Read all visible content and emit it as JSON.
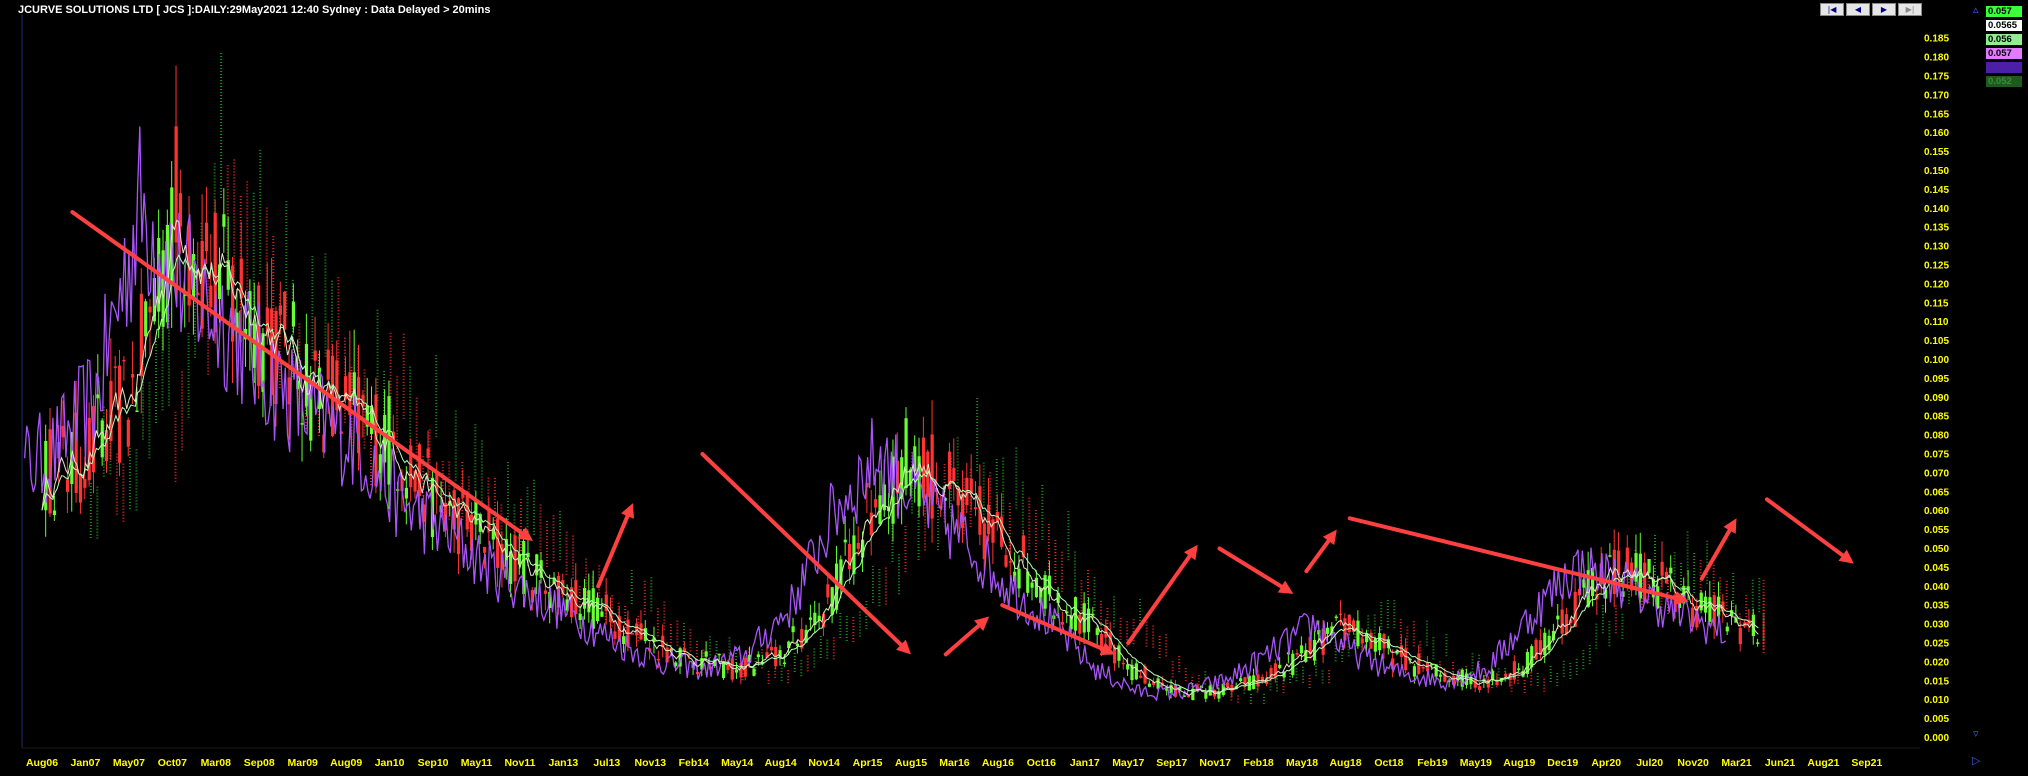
{
  "header": {
    "title": "JCURVE SOLUTIONS LTD [ JCS ]:DAILY:29May2021 12:40 Sydney : Data Delayed > 20mins"
  },
  "navigation": {
    "buttons": [
      {
        "label": "|◀",
        "enabled": true
      },
      {
        "label": "◀",
        "enabled": true
      },
      {
        "label": "▶",
        "enabled": true
      },
      {
        "label": "▶|",
        "enabled": false
      }
    ],
    "scroll_up_icon": "▵",
    "scroll_down_icon": "▿",
    "scroll_right_icon": "▷"
  },
  "price_tags": [
    {
      "value": "0.057",
      "bg": "#3cff3c",
      "fg": "#000000"
    },
    {
      "value": "0.0565",
      "bg": "#ffffff",
      "fg": "#000000"
    },
    {
      "value": "0.056",
      "bg": "#90ee90",
      "fg": "#000000"
    },
    {
      "value": "0.057",
      "bg": "#e27bff",
      "fg": "#000000"
    },
    {
      "value": "",
      "bg": "#4b1fa6",
      "fg": "#4b1fa6"
    },
    {
      "value": "0.052",
      "bg": "#1e5a1e",
      "fg": "#3a8a3a"
    }
  ],
  "colors": {
    "background": "#000000",
    "axis_text": "#ffff00",
    "up_candle": "#66ff33",
    "down_candle": "#ff3333",
    "lagging_line": "#a855f7",
    "ma_line": "#e6e6c8",
    "ma_line_2": "#b6ffb6",
    "cloud_red": "#ff3030",
    "cloud_green": "#22aa22",
    "annotation_arrow": "#ff4040"
  },
  "chart_data": {
    "type": "line",
    "x_tick_labels": [
      "Aug06",
      "Jan07",
      "May07",
      "Oct07",
      "Mar08",
      "Sep08",
      "Mar09",
      "Aug09",
      "Jan10",
      "Sep10",
      "May11",
      "Nov11",
      "Jan13",
      "Jul13",
      "Nov13",
      "Feb14",
      "May14",
      "Aug14",
      "Nov14",
      "Apr15",
      "Aug15",
      "Mar16",
      "Aug16",
      "Oct16",
      "Jan17",
      "May17",
      "Sep17",
      "Nov17",
      "Feb18",
      "May18",
      "Aug18",
      "Oct18",
      "Feb19",
      "May19",
      "Aug19",
      "Dec19",
      "Apr20",
      "Jul20",
      "Nov20",
      "Mar21",
      "Jun21",
      "Aug21",
      "Sep21"
    ],
    "y_tick_labels": [
      "0.185",
      "0.180",
      "0.175",
      "0.170",
      "0.165",
      "0.160",
      "0.155",
      "0.150",
      "0.145",
      "0.140",
      "0.135",
      "0.130",
      "0.125",
      "0.120",
      "0.115",
      "0.110",
      "0.105",
      "0.100",
      "0.095",
      "0.090",
      "0.085",
      "0.080",
      "0.075",
      "0.070",
      "0.065",
      "0.060",
      "0.055",
      "0.050",
      "0.045",
      "0.040",
      "0.035",
      "0.030",
      "0.025",
      "0.020",
      "0.015",
      "0.010",
      "0.005",
      "0.000"
    ],
    "ylim": [
      0,
      0.185
    ],
    "x": [
      0,
      1,
      2,
      3,
      4,
      5,
      6,
      7,
      8,
      9,
      10,
      11,
      12,
      13,
      14,
      15,
      16,
      17,
      18,
      19,
      20,
      21,
      22,
      23,
      24,
      25,
      26,
      27,
      28,
      29,
      30,
      31,
      32,
      33,
      34,
      35,
      36,
      37,
      38,
      39
    ],
    "price_series": [
      0.07,
      0.075,
      0.09,
      0.14,
      0.12,
      0.11,
      0.095,
      0.085,
      0.078,
      0.062,
      0.055,
      0.045,
      0.038,
      0.032,
      0.025,
      0.02,
      0.018,
      0.022,
      0.035,
      0.06,
      0.075,
      0.062,
      0.052,
      0.04,
      0.03,
      0.018,
      0.012,
      0.012,
      0.015,
      0.022,
      0.03,
      0.022,
      0.017,
      0.015,
      0.018,
      0.032,
      0.045,
      0.042,
      0.035,
      0.03
    ],
    "price_series_2": [
      0.04,
      0.047,
      0.05,
      0.04,
      0.038,
      0.035,
      0.03,
      0.03,
      0.031,
      0.03,
      0.028,
      0.03,
      0.032,
      0.03,
      0.028,
      0.028,
      0.038,
      0.055,
      0.06,
      0.057
    ],
    "arrows": [
      {
        "from": [
          0.7,
          0.139
        ],
        "to": [
          11.3,
          0.052
        ]
      },
      {
        "from": [
          12.8,
          0.04
        ],
        "to": [
          13.6,
          0.062
        ]
      },
      {
        "from": [
          15.2,
          0.075
        ],
        "to": [
          20.0,
          0.022
        ]
      },
      {
        "from": [
          20.8,
          0.022
        ],
        "to": [
          21.8,
          0.032
        ]
      },
      {
        "from": [
          22.1,
          0.035
        ],
        "to": [
          24.7,
          0.022
        ]
      },
      {
        "from": [
          25.0,
          0.025
        ],
        "to": [
          26.6,
          0.051
        ]
      },
      {
        "from": [
          27.1,
          0.05
        ],
        "to": [
          28.8,
          0.038
        ]
      },
      {
        "from": [
          29.1,
          0.044
        ],
        "to": [
          29.8,
          0.055
        ]
      },
      {
        "from": [
          30.1,
          0.058
        ],
        "to": [
          37.9,
          0.036
        ]
      },
      {
        "from": [
          38.2,
          0.042
        ],
        "to": [
          39.0,
          0.058
        ]
      },
      {
        "from": [
          39.7,
          0.063
        ],
        "to": [
          41.7,
          0.046
        ]
      }
    ],
    "grid": false,
    "legend": "none"
  }
}
